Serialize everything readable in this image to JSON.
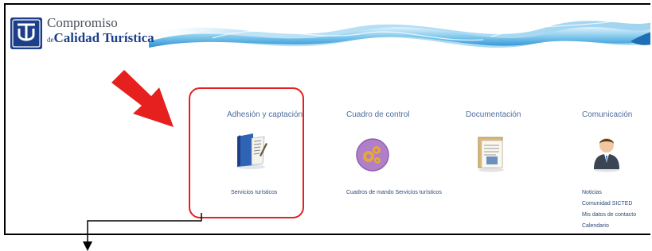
{
  "brand": {
    "line1": "Compromiso",
    "line2_prefix": "de",
    "line2_main": "Calidad Turística",
    "color": "#1d3f8a"
  },
  "sections": [
    {
      "title": "Adhesión y captación",
      "icon": "book-icon",
      "links": [
        "Servicios turísticos"
      ]
    },
    {
      "title": "Cuadro de control",
      "icon": "gears-icon",
      "links": [
        "Cuadros de mando Servicios turísticos"
      ]
    },
    {
      "title": "Documentación",
      "icon": "document-icon",
      "links": []
    },
    {
      "title": "Comunicación",
      "icon": "user-icon",
      "links": [
        "Noticias",
        "Comunidad SICTED",
        "Mis datos de contacto",
        "Calendario"
      ]
    }
  ],
  "colors": {
    "accent_title": "#4d6d9e",
    "link": "#2d4a78",
    "annotation_red": "#e61f1f",
    "wave_blue": "#3ca0d8"
  }
}
